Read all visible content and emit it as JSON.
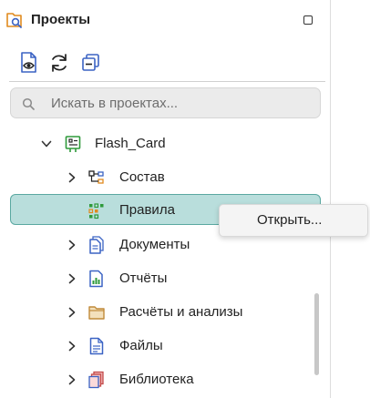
{
  "panel": {
    "title": "Проекты",
    "icon": "folder-search-icon"
  },
  "toolbar": {
    "buttons": [
      {
        "icon": "document-view-icon"
      },
      {
        "icon": "refresh-icon"
      },
      {
        "icon": "collapse-all-icon"
      }
    ]
  },
  "search": {
    "placeholder": "Искать в проектах..."
  },
  "tree": {
    "project": {
      "label": "Flash_Card",
      "icon": "project-board-icon",
      "expanded": true
    },
    "items": [
      {
        "label": "Состав",
        "icon": "hierarchy-icon",
        "expandable": true
      },
      {
        "label": "Правила",
        "icon": "rules-grid-icon",
        "expandable": false,
        "selected": true
      },
      {
        "label": "Документы",
        "icon": "documents-icon",
        "expandable": true
      },
      {
        "label": "Отчёты",
        "icon": "report-chart-icon",
        "expandable": true
      },
      {
        "label": "Расчёты и анализы",
        "icon": "folder-icon",
        "expandable": true
      },
      {
        "label": "Файлы",
        "icon": "file-icon",
        "expandable": true
      },
      {
        "label": "Библиотека",
        "icon": "library-books-icon",
        "expandable": true
      }
    ]
  },
  "context_menu": {
    "items": [
      {
        "label": "Открыть..."
      }
    ]
  },
  "colors": {
    "selection_bg": "#b9dedc",
    "selection_border": "#5aa8a1",
    "accent_blue": "#3b63c4",
    "accent_green": "#2e9a3a",
    "accent_orange": "#e08a1e"
  }
}
